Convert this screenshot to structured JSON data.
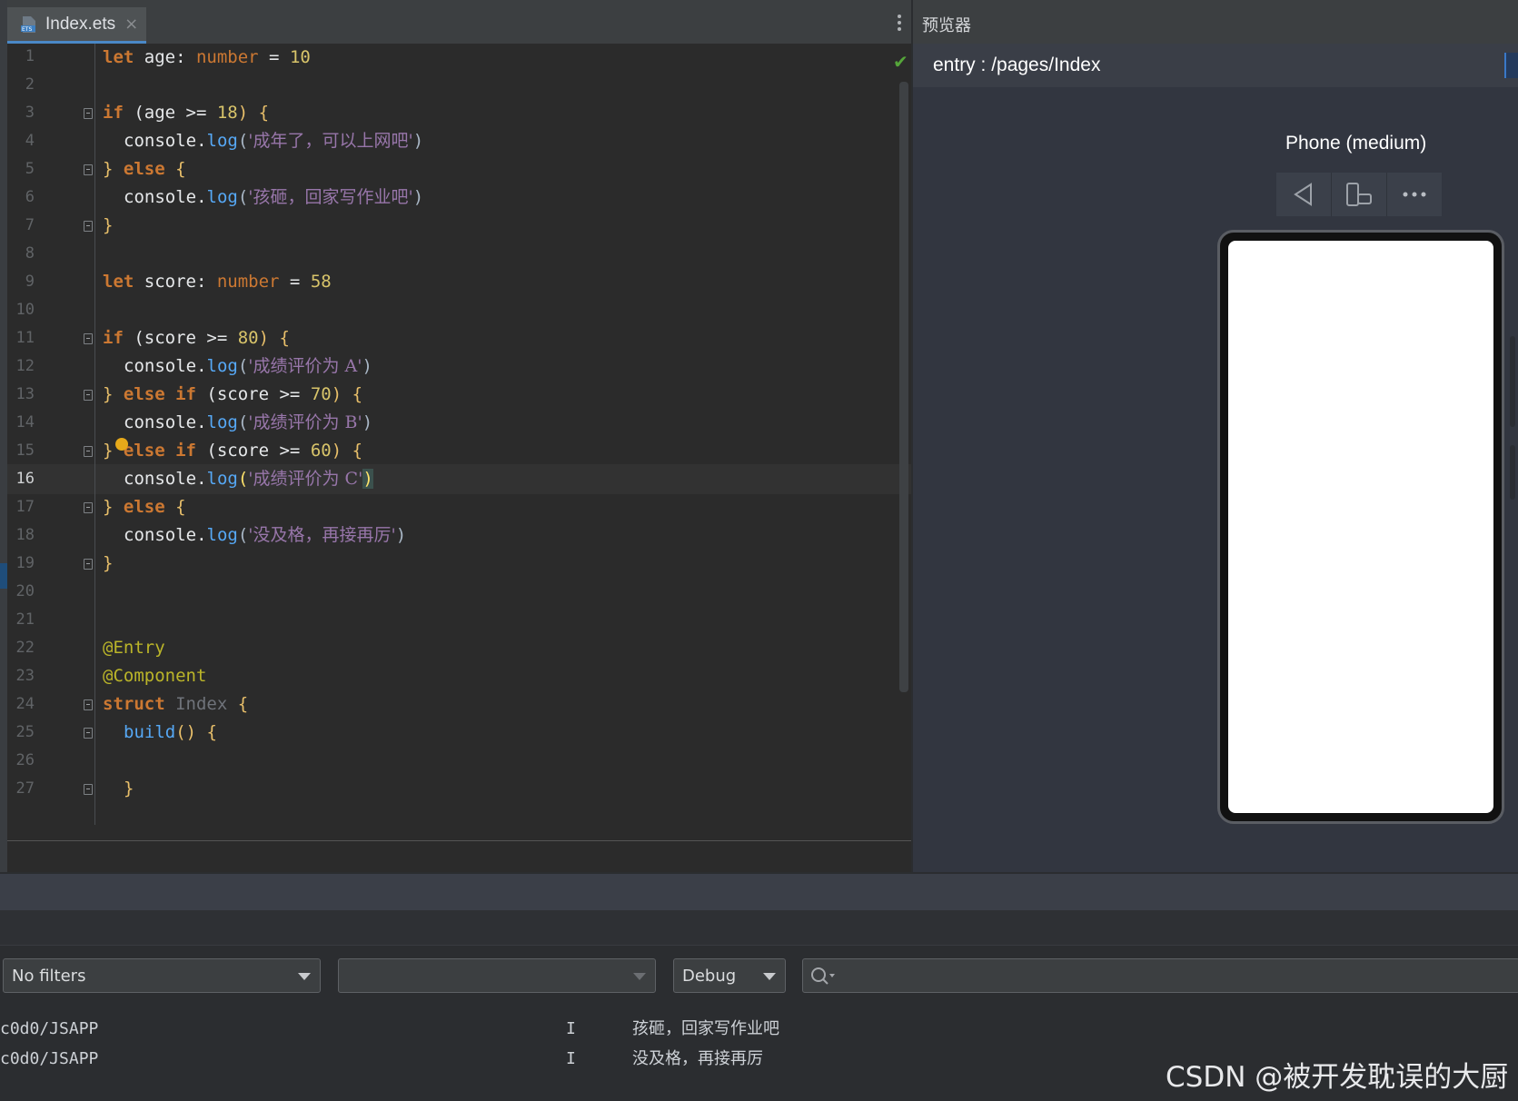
{
  "editor": {
    "tab_title": "Index.ets",
    "tab_close": "×",
    "current_line": 16,
    "line_numbers": [
      "1",
      "2",
      "3",
      "4",
      "5",
      "6",
      "7",
      "8",
      "9",
      "10",
      "11",
      "12",
      "13",
      "14",
      "15",
      "16",
      "17",
      "18",
      "19",
      "20",
      "21",
      "22",
      "23",
      "24",
      "25",
      "26",
      "27"
    ],
    "code": {
      "l1": {
        "kw": "let",
        "rest": " age: ",
        "type": "number",
        "eq": " = ",
        "num": "10"
      },
      "l3": {
        "kw": "if",
        "a": " (age >= ",
        "num": "18",
        "b": ") {"
      },
      "l4": {
        "obj": "console.",
        "fn": "log",
        "open": "(",
        "str": "'成年了，可以上网吧'",
        "close": ")"
      },
      "l5": {
        "a": "} ",
        "kw": "else",
        "b": " {"
      },
      "l6": {
        "obj": "console.",
        "fn": "log",
        "open": "(",
        "str": "'孩砸，回家写作业吧'",
        "close": ")"
      },
      "l7": {
        "a": "}"
      },
      "l9": {
        "kw": "let",
        "rest": " score: ",
        "type": "number",
        "eq": " = ",
        "num": "58"
      },
      "l11": {
        "kw": "if",
        "a": " (score >= ",
        "num": "80",
        "b": ") {"
      },
      "l12": {
        "obj": "console.",
        "fn": "log",
        "open": "(",
        "str": "'成绩评价为 A'",
        "close": ")"
      },
      "l13": {
        "a": "} ",
        "kw": "else if",
        "b": " (score >= ",
        "num": "70",
        "c": ") {"
      },
      "l14": {
        "obj": "console.",
        "fn": "log",
        "open": "(",
        "str": "'成绩评价为 B'",
        "close": ")"
      },
      "l15": {
        "a": "} ",
        "kw": "else if",
        "b": " (score >= ",
        "num": "60",
        "c": ") {"
      },
      "l16": {
        "obj": "console.",
        "fn": "log",
        "open": "(",
        "str": "'成绩评价为 C'",
        "close": ")"
      },
      "l17": {
        "a": "} ",
        "kw": "else",
        "b": " {"
      },
      "l18": {
        "obj": "console.",
        "fn": "log",
        "open": "(",
        "str": "'没及格，再接再厉'",
        "close": ")"
      },
      "l19": {
        "a": "}"
      },
      "l22": {
        "ann": "@Entry"
      },
      "l23": {
        "ann": "@Component"
      },
      "l24": {
        "kw": "struct",
        "cls": " Index",
        "b": " {"
      },
      "l25": {
        "fn": "build",
        "b": "() {"
      },
      "l27": {
        "a": "}"
      }
    }
  },
  "preview": {
    "title": "预览器",
    "route": "entry : /pages/Index",
    "device_name": "Phone (medium)"
  },
  "log": {
    "filter_select": "No filters",
    "process_select": "",
    "level_select": "Debug",
    "search_placeholder": "",
    "rows": [
      {
        "tag": "c0d0/JSAPP",
        "level": "I",
        "message": "孩砸，回家写作业吧"
      },
      {
        "tag": "c0d0/JSAPP",
        "level": "I",
        "message": "没及格，再接再厉"
      }
    ]
  },
  "watermark": "CSDN @被开发耽误的大厨",
  "colors": {
    "keyword": "#cc7832",
    "string": "#9876aa",
    "number": "#d8c46a",
    "function": "#56a8f5",
    "annotation": "#bbb529",
    "check": "#55a53a"
  }
}
